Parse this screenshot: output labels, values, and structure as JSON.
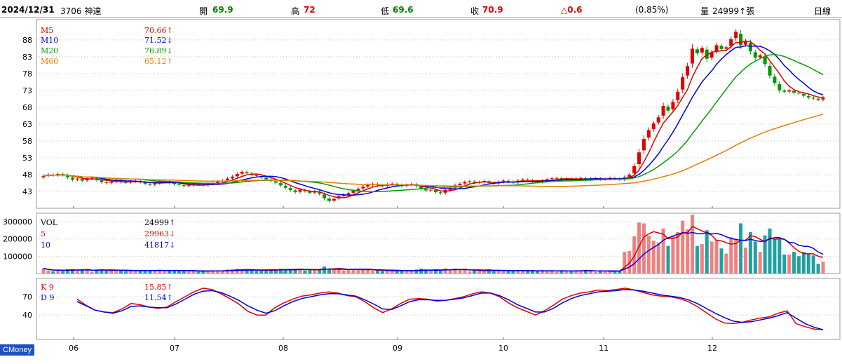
{
  "header": {
    "date": "2024/12/31",
    "stock": "3706 神達",
    "open_label": "開",
    "open": "69.9",
    "high_label": "高",
    "high": "72",
    "low_label": "低",
    "low": "69.6",
    "close_label": "收",
    "close": "70.9",
    "change": "△0.6",
    "change_pct": "(0.85%)",
    "volume_label": "量",
    "volume": "24999↑張",
    "period": "日線"
  },
  "legends": {
    "ma": [
      {
        "name": "M5",
        "value": "70.66↑",
        "color": "#e00000"
      },
      {
        "name": "M10",
        "value": "71.52↓",
        "color": "#0000e0"
      },
      {
        "name": "M20",
        "value": "76.89↓",
        "color": "#00a000"
      },
      {
        "name": "M60",
        "value": "65.12↑",
        "color": "#e08000"
      }
    ],
    "vol": [
      {
        "name": "VOL",
        "value": "24999↑",
        "color": "#000"
      },
      {
        "name": "5",
        "value": "29963↓",
        "color": "#e00000"
      },
      {
        "name": "10",
        "value": "41817↓",
        "color": "#0000e0"
      }
    ],
    "kd": [
      {
        "name": "K 9",
        "value": "15.85↑",
        "color": "#e00000"
      },
      {
        "name": "D 9",
        "value": "11.54↑",
        "color": "#0000e0"
      }
    ]
  },
  "brand": "CMoney",
  "colors": {
    "up": "#e00000",
    "down": "#009900",
    "vol_up": "#f08080",
    "vol_down": "#20a0a0",
    "grid": "#c0c0c0",
    "frame": "#999999"
  },
  "chart_data": [
    {
      "type": "candlestick",
      "title": "3706 神達 日線",
      "ylim": [
        38,
        94
      ],
      "yticks": [
        43,
        48,
        53,
        58,
        63,
        68,
        73,
        78,
        83,
        88
      ],
      "x_ticks": [
        "06",
        "07",
        "08",
        "09",
        "10",
        "11",
        "12"
      ],
      "close": [
        47.6,
        48.0,
        47.8,
        48.2,
        47.9,
        47.2,
        46.5,
        46.8,
        46.2,
        46.9,
        47.0,
        46.4,
        45.8,
        45.5,
        45.9,
        46.3,
        45.8,
        45.6,
        45.9,
        46.2,
        45.8,
        45.3,
        45.0,
        45.4,
        45.9,
        46.1,
        45.6,
        45.2,
        44.9,
        44.6,
        44.8,
        45.1,
        45.0,
        44.8,
        45.2,
        45.5,
        45.9,
        46.2,
        46.8,
        47.4,
        48.2,
        48.8,
        48.4,
        47.9,
        47.6,
        47.2,
        46.6,
        46.1,
        45.6,
        44.8,
        44.1,
        43.4,
        42.8,
        43.5,
        43.1,
        42.6,
        43.0,
        42.3,
        41.0,
        40.2,
        40.8,
        41.6,
        42.0,
        42.5,
        43.2,
        43.8,
        44.4,
        44.9,
        45.2,
        44.8,
        44.6,
        45.1,
        45.3,
        45.0,
        44.6,
        44.9,
        45.2,
        44.6,
        43.8,
        43.3,
        43.5,
        42.8,
        42.5,
        43.4,
        44.0,
        44.8,
        45.3,
        45.8,
        46.0,
        45.6,
        45.8,
        46.1,
        45.5,
        45.3,
        45.8,
        46.2,
        45.9,
        45.7,
        46.2,
        46.5,
        46.3,
        46.0,
        45.8,
        46.2,
        46.6,
        46.9,
        47.0,
        46.6,
        46.8,
        46.4,
        46.8,
        47.0,
        46.5,
        46.8,
        46.9,
        46.6,
        46.7,
        47.0,
        46.8,
        46.5,
        47.2,
        48.0,
        50.5,
        54.6,
        58.6,
        61.2,
        63.2,
        65.0,
        68.4,
        67.0,
        69.6,
        72.6,
        76.9,
        80.2,
        85.4,
        84.0,
        85.6,
        82.4,
        84.3,
        86.4,
        85.3,
        85.8,
        88.2,
        90.4,
        86.4,
        87.6,
        84.6,
        82.7,
        83.4,
        80.8,
        77.4,
        75.2,
        73.0,
        72.6,
        73.0,
        72.3,
        72.1,
        71.4,
        70.9,
        70.6,
        70.2,
        70.9
      ],
      "kd": {
        "K": [
          66,
          56,
          48,
          45,
          44,
          50,
          59,
          57,
          53,
          51,
          53,
          62,
          70,
          78,
          84,
          82,
          75,
          67,
          58,
          46,
          40,
          40,
          52,
          60,
          66,
          71,
          73,
          76,
          78,
          76,
          72,
          70,
          62,
          52,
          44,
          50,
          59,
          66,
          67,
          66,
          63,
          64,
          67,
          70,
          75,
          78,
          76,
          70,
          60,
          52,
          46,
          40,
          47,
          56,
          66,
          72,
          76,
          78,
          81,
          80,
          82,
          84,
          81,
          77,
          73,
          71,
          70,
          67,
          62,
          54,
          44,
          34,
          27,
          26,
          28,
          32,
          35,
          37,
          43,
          47,
          26,
          21,
          17,
          16
        ],
        "D": [
          62,
          55,
          48,
          45,
          43,
          47,
          54,
          55,
          53,
          52,
          52,
          58,
          66,
          74,
          79,
          80,
          77,
          71,
          64,
          55,
          48,
          43,
          47,
          55,
          62,
          67,
          70,
          73,
          75,
          75,
          73,
          71,
          65,
          58,
          50,
          49,
          55,
          62,
          65,
          65,
          64,
          64,
          66,
          68,
          72,
          76,
          76,
          72,
          65,
          57,
          51,
          45,
          45,
          51,
          60,
          67,
          72,
          75,
          78,
          79,
          80,
          82,
          81,
          79,
          76,
          73,
          71,
          69,
          65,
          59,
          51,
          43,
          36,
          30,
          28,
          29,
          32,
          35,
          39,
          44,
          35,
          26,
          20,
          16
        ]
      },
      "volume_ylim": [
        0,
        300000
      ],
      "volume_yticks": [
        100000,
        200000,
        300000
      ]
    }
  ]
}
